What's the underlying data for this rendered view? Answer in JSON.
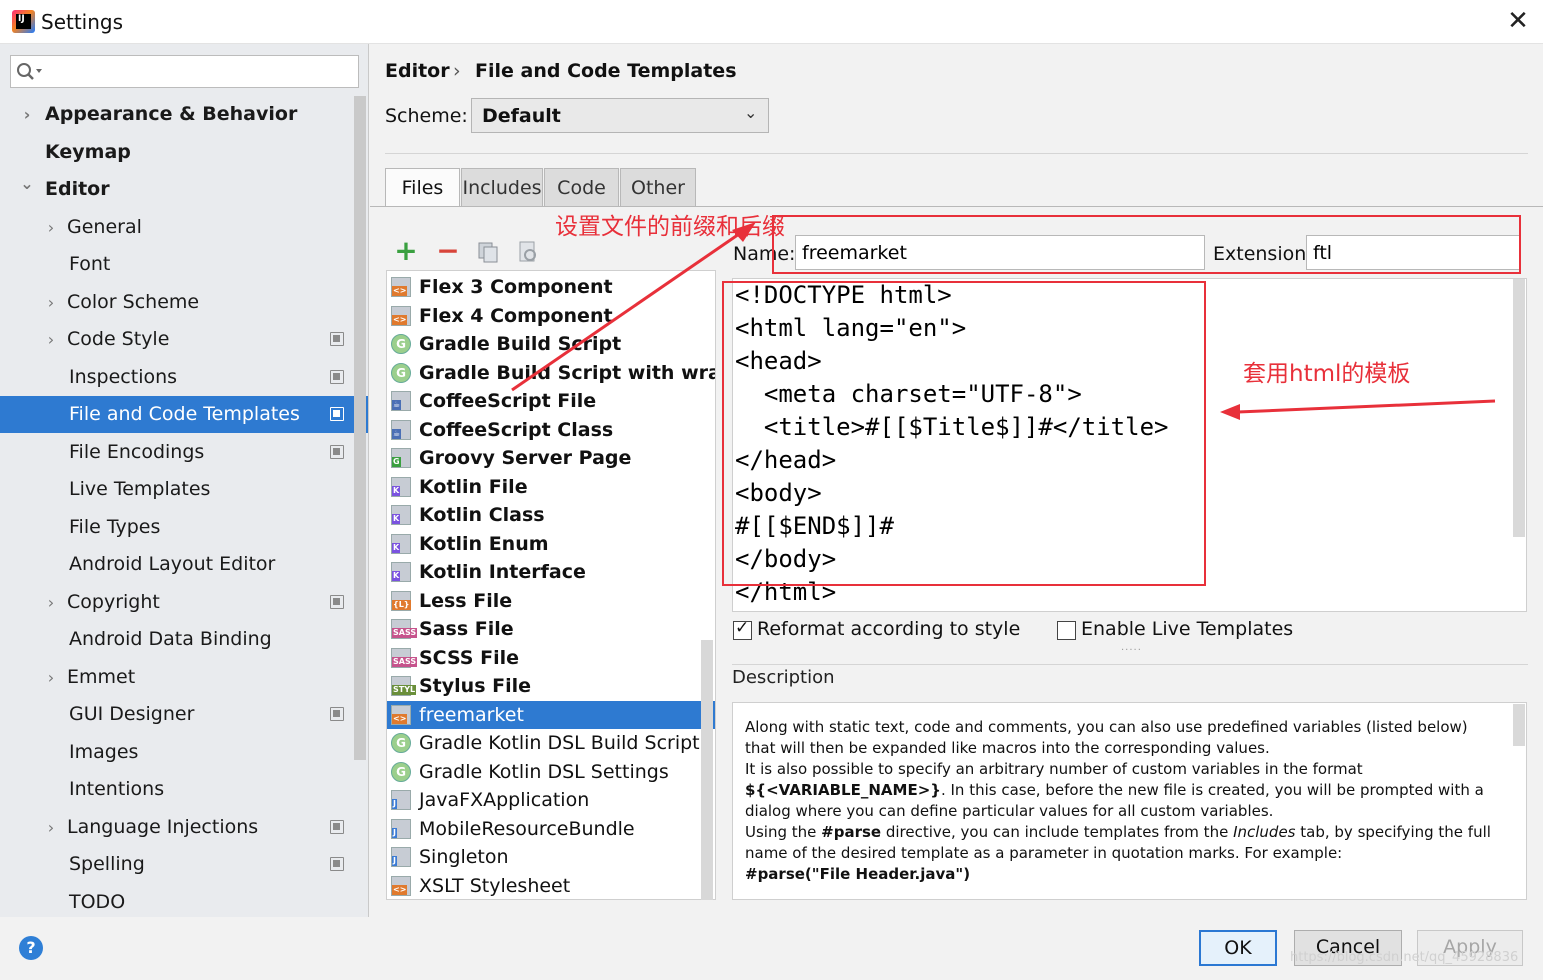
{
  "window": {
    "title": "Settings",
    "icon": "intellij-app-icon",
    "close": "close-icon"
  },
  "search": {
    "placeholder": "",
    "icon": "search-icon"
  },
  "tree": [
    {
      "label": "Appearance & Behavior",
      "chevron": "right",
      "bold": true,
      "indent": 0
    },
    {
      "label": "Keymap",
      "chevron": "",
      "bold": true,
      "indent": 0
    },
    {
      "label": "Editor",
      "chevron": "down",
      "bold": true,
      "indent": 0
    },
    {
      "label": "General",
      "chevron": "right",
      "bold": false,
      "indent": 1
    },
    {
      "label": "Font",
      "chevron": "",
      "bold": false,
      "indent": 1
    },
    {
      "label": "Color Scheme",
      "chevron": "right",
      "bold": false,
      "indent": 1
    },
    {
      "label": "Code Style",
      "chevron": "right",
      "bold": false,
      "indent": 1,
      "project": true
    },
    {
      "label": "Inspections",
      "chevron": "",
      "bold": false,
      "indent": 1,
      "project": true
    },
    {
      "label": "File and Code Templates",
      "chevron": "",
      "bold": false,
      "indent": 1,
      "project": true,
      "selected": true
    },
    {
      "label": "File Encodings",
      "chevron": "",
      "bold": false,
      "indent": 1,
      "project": true
    },
    {
      "label": "Live Templates",
      "chevron": "",
      "bold": false,
      "indent": 1
    },
    {
      "label": "File Types",
      "chevron": "",
      "bold": false,
      "indent": 1
    },
    {
      "label": "Android Layout Editor",
      "chevron": "",
      "bold": false,
      "indent": 1
    },
    {
      "label": "Copyright",
      "chevron": "right",
      "bold": false,
      "indent": 1,
      "project": true
    },
    {
      "label": "Android Data Binding",
      "chevron": "",
      "bold": false,
      "indent": 1
    },
    {
      "label": "Emmet",
      "chevron": "right",
      "bold": false,
      "indent": 1
    },
    {
      "label": "GUI Designer",
      "chevron": "",
      "bold": false,
      "indent": 1,
      "project": true
    },
    {
      "label": "Images",
      "chevron": "",
      "bold": false,
      "indent": 1
    },
    {
      "label": "Intentions",
      "chevron": "",
      "bold": false,
      "indent": 1
    },
    {
      "label": "Language Injections",
      "chevron": "right",
      "bold": false,
      "indent": 1,
      "project": true
    },
    {
      "label": "Spelling",
      "chevron": "",
      "bold": false,
      "indent": 1,
      "project": true
    },
    {
      "label": "TODO",
      "chevron": "",
      "bold": false,
      "indent": 1
    }
  ],
  "breadcrumb": {
    "parent": "Editor",
    "separator": "›",
    "current": "File and Code Templates"
  },
  "scheme": {
    "label": "Scheme:",
    "value": "Default"
  },
  "tabs": [
    "Files",
    "Includes",
    "Code",
    "Other"
  ],
  "active_tab": "Files",
  "toolbar": {
    "add": "add-icon",
    "remove": "remove-icon",
    "copy": "copy-icon",
    "reset": "reset-icon"
  },
  "templates": [
    {
      "label": "Flex 3 Component",
      "icon": "xml-file-icon",
      "bold": true
    },
    {
      "label": "Flex 4 Component",
      "icon": "xml-file-icon",
      "bold": true
    },
    {
      "label": "Gradle Build Script",
      "icon": "gradle-icon",
      "bold": true
    },
    {
      "label": "Gradle Build Script with wrapper",
      "icon": "gradle-icon",
      "bold": true
    },
    {
      "label": "CoffeeScript File",
      "icon": "coffeescript-icon",
      "bold": true
    },
    {
      "label": "CoffeeScript Class",
      "icon": "coffeescript-icon",
      "bold": true
    },
    {
      "label": "Groovy Server Page",
      "icon": "groovy-icon",
      "bold": true
    },
    {
      "label": "Kotlin File",
      "icon": "kotlin-icon",
      "bold": true
    },
    {
      "label": "Kotlin Class",
      "icon": "kotlin-icon",
      "bold": true
    },
    {
      "label": "Kotlin Enum",
      "icon": "kotlin-icon",
      "bold": true
    },
    {
      "label": "Kotlin Interface",
      "icon": "kotlin-icon",
      "bold": true
    },
    {
      "label": "Less File",
      "icon": "less-icon",
      "bold": true
    },
    {
      "label": "Sass File",
      "icon": "sass-icon",
      "bold": true
    },
    {
      "label": "SCSS File",
      "icon": "sass-icon",
      "bold": true
    },
    {
      "label": "Stylus File",
      "icon": "stylus-icon",
      "bold": true
    },
    {
      "label": "freemarket",
      "icon": "xml-file-icon",
      "bold": false,
      "selected": true
    },
    {
      "label": "Gradle Kotlin DSL Build Script",
      "icon": "gradle-icon",
      "bold": false
    },
    {
      "label": "Gradle Kotlin DSL Settings",
      "icon": "gradle-icon",
      "bold": false
    },
    {
      "label": "JavaFXApplication",
      "icon": "java-file-icon",
      "bold": false
    },
    {
      "label": "MobileResourceBundle",
      "icon": "java-file-icon",
      "bold": false
    },
    {
      "label": "Singleton",
      "icon": "java-file-icon",
      "bold": false
    },
    {
      "label": "XSLT Stylesheet",
      "icon": "xml-file-icon",
      "bold": false
    }
  ],
  "name_field": {
    "label": "Name:",
    "value": "freemarket"
  },
  "extension_field": {
    "label": "Extension:",
    "value": "ftl"
  },
  "code": [
    "<!DOCTYPE html>",
    "<html lang=\"en\">",
    "<head>",
    "  <meta charset=\"UTF-8\">",
    "  <title>#[[$Title$]]#</title>",
    "</head>",
    "<body>",
    "#[[$END$]]#",
    "</body>",
    "</html>"
  ],
  "options": {
    "reformat": "Reformat according to style",
    "reformat_checked": true,
    "live_templates": "Enable Live Templates",
    "live_checked": false
  },
  "description": {
    "label": "Description",
    "lines": [
      [
        {
          "t": "Along with static text, code and comments, you can also use predefined variables (listed below)"
        }
      ],
      [
        {
          "t": "that will then be expanded like macros into the corresponding values."
        }
      ],
      [
        {
          "t": "It is also possible to specify an arbitrary number of custom variables in the format"
        }
      ],
      [
        {
          "t": "${<VARIABLE_NAME>}",
          "b": true
        },
        {
          "t": ". In this case, before the new file is created, you will be prompted with a"
        }
      ],
      [
        {
          "t": "dialog where you can define particular values for all custom variables."
        }
      ],
      [
        {
          "t": "Using the "
        },
        {
          "t": "#parse",
          "b": true
        },
        {
          "t": " directive, you can include templates from the "
        },
        {
          "t": "Includes",
          "i": true
        },
        {
          "t": " tab, by specifying the full"
        }
      ],
      [
        {
          "t": "name of the desired template as a parameter in quotation marks. For example:"
        }
      ],
      [
        {
          "t": "#parse(\"File Header.java\")",
          "b": true
        }
      ]
    ]
  },
  "buttons": {
    "ok": "OK",
    "cancel": "Cancel",
    "apply": "Apply",
    "help": "?"
  },
  "watermark": "https://blog.csdn.net/qq_45928836",
  "annotations": {
    "prefix_suffix": "设置文件的前缀和后缀",
    "html_template": "套用html的模板",
    "color": "#e8303a"
  }
}
